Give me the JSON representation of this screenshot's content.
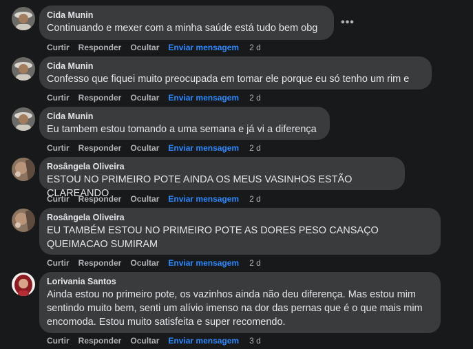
{
  "colors": {
    "background": "#18191a",
    "bubble": "#3a3b3c",
    "text": "#e4e6eb",
    "muted": "#b0b3b8",
    "link": "#2e89ff"
  },
  "actions": {
    "like": "Curtir",
    "reply": "Responder",
    "hide": "Ocultar",
    "message": "Enviar mensagem"
  },
  "more_icon": "more-horizontal-icon",
  "comments": [
    {
      "author": "Cida Munin",
      "text": "Continuando e mexer com a minha saúde está tudo bem obg",
      "time": "2 d"
    },
    {
      "author": "Cida Munin",
      "text": "Confesso que fiquei muito preocupada em tomar ele porque eu só tenho um rim e",
      "time": "2 d"
    },
    {
      "author": "Cida Munin",
      "text": "Eu tambem estou tomando a uma semana e já vi a diferença",
      "time": "2 d"
    },
    {
      "author": "Rosângela Oliveira",
      "text": "ESTOU NO PRIMEIRO POTE AINDA OS MEUS VASINHOS ESTÃO CLAREANDO",
      "time": "2 d"
    },
    {
      "author": "Rosângela Oliveira",
      "text": "EU TAMBÉM ESTOU NO PRIMEIRO POTE AS DORES PESO CANSAÇO QUEIMACAO SUMIRAM",
      "time": "2 d"
    },
    {
      "author": "Lorivania Santos",
      "text": "Ainda estou no primeiro pote, os vazinhos ainda não deu diferença. Mas estou mim sentindo muito bem, senti um alívio imenso na dor das pernas que é o que mais mim encomoda. Estou muito satisfeita e super recomendo.",
      "time": "3 d"
    }
  ]
}
